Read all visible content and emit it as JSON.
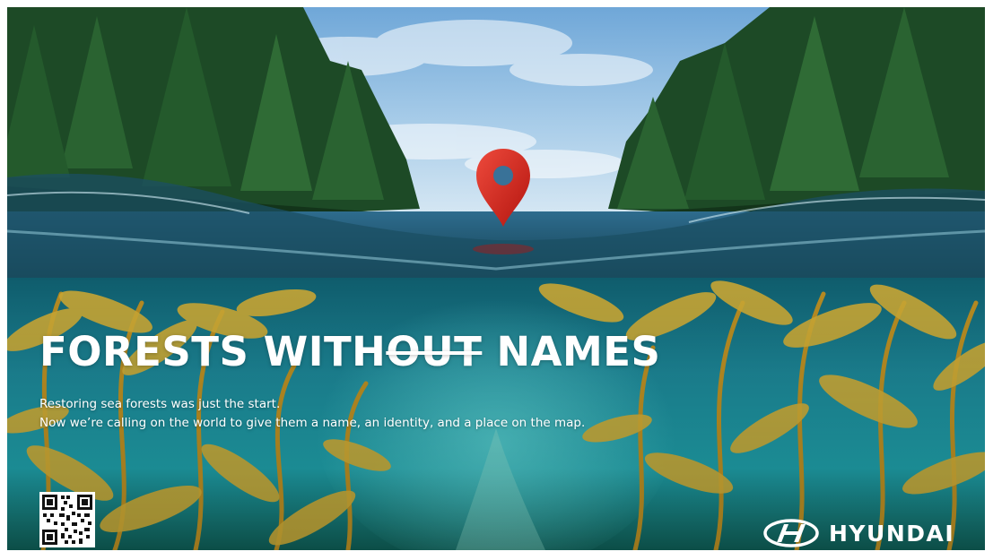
{
  "headline": {
    "part1": "FORESTS WITH",
    "strike": "OUT",
    "part2": " NAMES"
  },
  "body": {
    "line1": "Restoring sea forests was just the start.",
    "line2": "Now we’re calling on the world to give them a name, an identity, and a place on the map."
  },
  "brand": {
    "name": "HYUNDAI"
  },
  "colors": {
    "pin": "#d6271f",
    "water": "#1f8c96",
    "kelp": "#c8a634",
    "sky": "#7fb3dc",
    "forest": "#1f4a24"
  },
  "icons": {
    "pin": "map-pin-icon",
    "qr": "qr-code-icon",
    "logo": "hyundai-logo-icon"
  }
}
